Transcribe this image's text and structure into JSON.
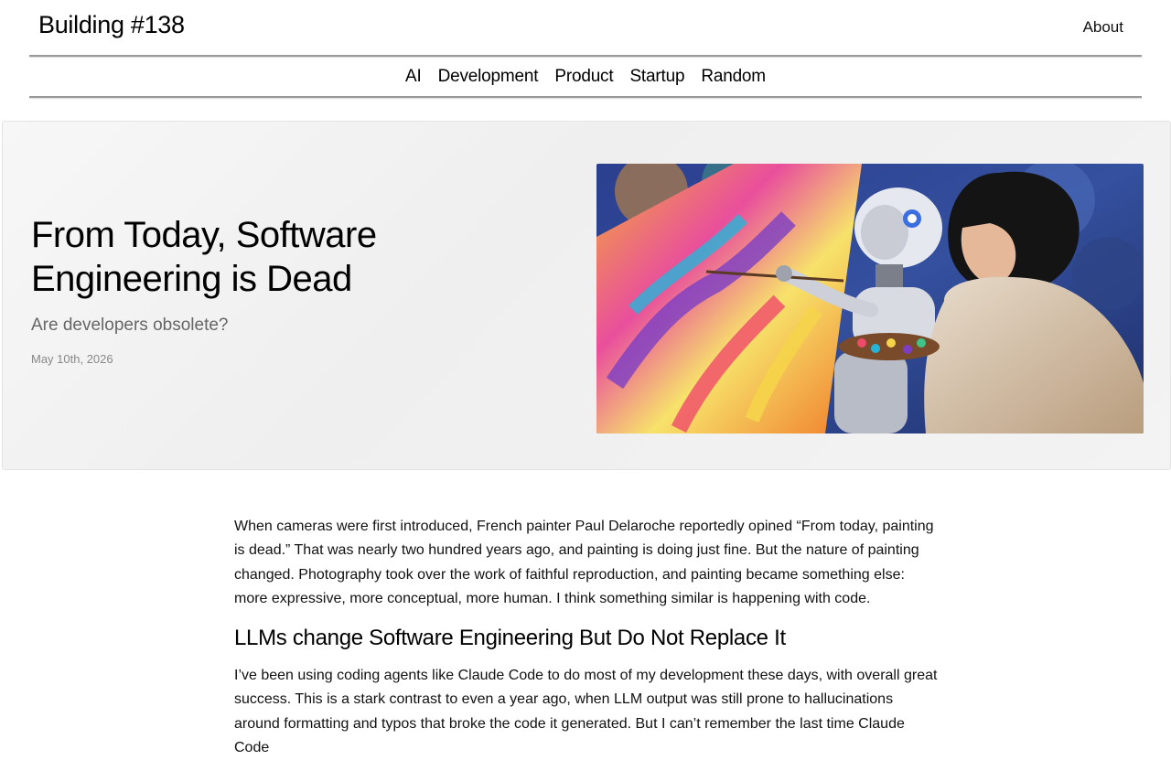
{
  "header": {
    "site_title": "Building #138",
    "about_label": "About"
  },
  "categories": [
    "AI",
    "Development",
    "Product",
    "Startup",
    "Random"
  ],
  "hero": {
    "title": "From Today, Software Engineering is Dead",
    "subtitle": "Are developers obsolete?",
    "date": "May 10th, 2026",
    "image_icon": "robot-and-woman-painting-canvas"
  },
  "article": {
    "paragraph_1": "When cameras were first introduced, French painter Paul Delaroche reportedly opined “From today, painting is dead.” That was nearly two hundred years ago, and painting is doing just fine. But the nature of painting changed. Photography took over the work of faithful reproduction, and painting became something else: more expressive, more conceptual, more human. I think something similar is happening with code.",
    "heading_1": "LLMs change Software Engineering But Do Not Replace It",
    "paragraph_2": "I’ve been using coding agents like Claude Code to do most of my development these days, with overall great success. This is a stark contrast to even a year ago, when LLM output was still prone to hallucinations around formatting and typos that broke the code it generated. But I can’t remember the last time Claude Code"
  },
  "colors": {
    "rule": "#999999",
    "subtitle": "#666666",
    "date": "#888888"
  }
}
